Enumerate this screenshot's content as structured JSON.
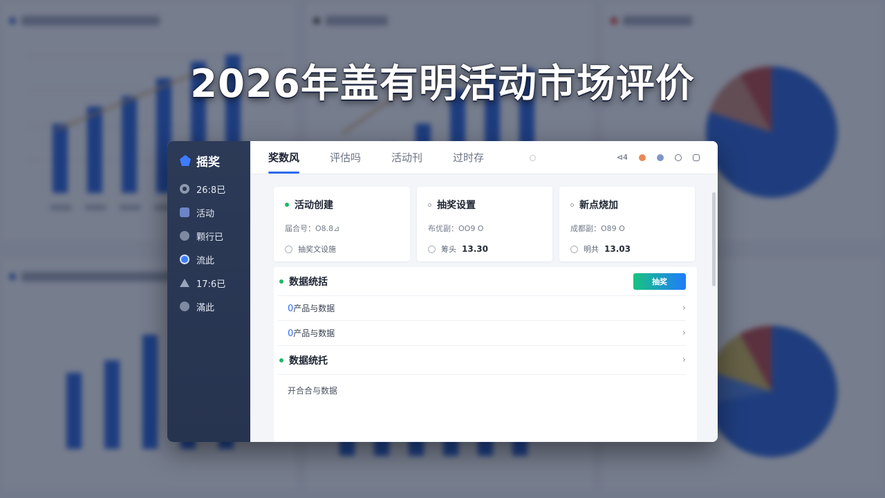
{
  "hero": {
    "title": "2026年盖有明活动市场评价"
  },
  "sidebar": {
    "brand": "摇奖",
    "items": [
      {
        "label": "26:8已",
        "icon": "gear-icon"
      },
      {
        "label": "活动",
        "icon": "square-icon"
      },
      {
        "label": "颗行已",
        "icon": "circle-icon"
      },
      {
        "label": "流此",
        "icon": "check-badge-icon"
      },
      {
        "label": "17:6已",
        "icon": "person-icon"
      },
      {
        "label": "滿此",
        "icon": "circle-icon"
      }
    ]
  },
  "topbar": {
    "tabs": [
      {
        "label": "奖数风",
        "active": true
      },
      {
        "label": "评估吗"
      },
      {
        "label": "活动刊"
      },
      {
        "label": "过时存"
      }
    ],
    "tools": {
      "text": "⊲4",
      "colors": [
        "#e8895a",
        "#7f96c7"
      ]
    }
  },
  "cards": [
    {
      "title": "活动创建",
      "sub": "届合号：O8.8⊿",
      "line_label": "抽奖文设施",
      "line_value": ""
    },
    {
      "title": "抽奖设置",
      "sub": "布优副：OO9 O",
      "line_label": "筹头",
      "line_value": "13.30"
    },
    {
      "title": "新点烧加",
      "sub": "成都副：O89 O",
      "line_label": "明共",
      "line_value": "13.03"
    }
  ],
  "panel": {
    "title": "数据统括",
    "button": "抽奖",
    "rows": [
      {
        "zero": "0",
        "text": "产品与数据"
      },
      {
        "zero": "0",
        "text": "产品与数据"
      }
    ],
    "section2": "数据统托",
    "footer": "开合合与数据"
  },
  "colors": {
    "accent": "#2e6bef",
    "sidebar": "#2c3a57",
    "green": "#1fb86a"
  }
}
